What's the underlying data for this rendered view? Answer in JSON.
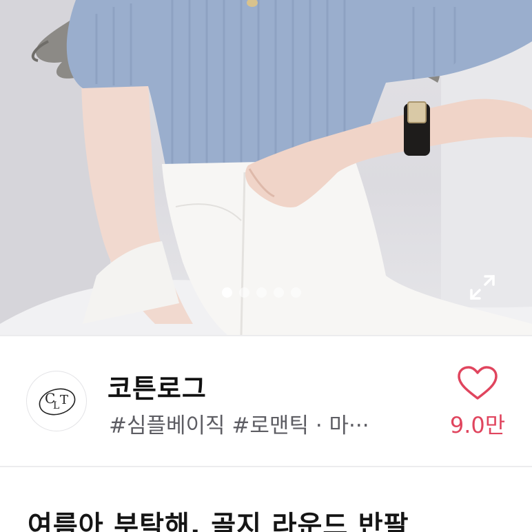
{
  "hero": {
    "slide_count": 5,
    "active_slide": 1
  },
  "brand": {
    "logo_text": "CLT",
    "name": "코튼로그",
    "tags": "#심플베이직 #로맨틱 · 마···"
  },
  "likes": {
    "count": "9.0만"
  },
  "product": {
    "title": "여름아 부탁해, 골지 라운드 반팔"
  },
  "icons": {
    "heart": "heart-outline-icon",
    "expand": "expand-icon"
  },
  "colors": {
    "accent_pink": "#e0455e",
    "knit_blue": "#9aaecd"
  }
}
